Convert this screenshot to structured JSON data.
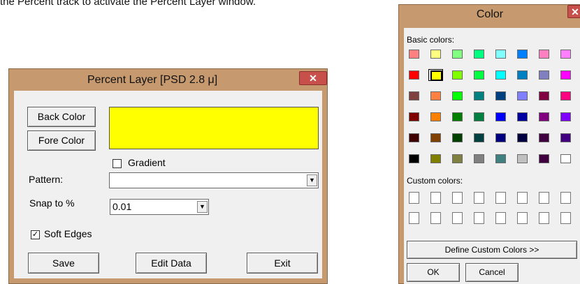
{
  "caption": "the Percent track to activate the Percent Layer window.",
  "percent_layer": {
    "title": "Percent Layer [PSD 2.8 μ]",
    "close_glyph": "✕",
    "back_color_label": "Back Color",
    "fore_color_label": "Fore Color",
    "preview_color": "#ffff00",
    "gradient_label": "Gradient",
    "gradient_checked": false,
    "pattern_label": "Pattern:",
    "pattern_value": "",
    "snap_label": "Snap to %",
    "snap_value": "0.01",
    "soft_edges_label": "Soft Edges",
    "soft_edges_checked": true,
    "save_label": "Save",
    "edit_data_label": "Edit Data",
    "exit_label": "Exit"
  },
  "color_dialog": {
    "title": "Color",
    "close_glyph": "✕",
    "basic_colors_label": "Basic colors:",
    "basic_colors": [
      [
        "#ff8080",
        "#ffff80",
        "#80ff80",
        "#00ff80",
        "#80ffff",
        "#0080ff",
        "#ff80c0",
        "#ff80ff"
      ],
      [
        "#ff0000",
        "#ffff00",
        "#80ff00",
        "#00ff40",
        "#00ffff",
        "#0080c0",
        "#8080c0",
        "#ff00ff"
      ],
      [
        "#804040",
        "#ff8040",
        "#00ff00",
        "#008080",
        "#004080",
        "#8080ff",
        "#800040",
        "#ff0080"
      ],
      [
        "#800000",
        "#ff8000",
        "#008000",
        "#008040",
        "#0000ff",
        "#0000a0",
        "#800080",
        "#8000ff"
      ],
      [
        "#400000",
        "#804000",
        "#004000",
        "#004040",
        "#000080",
        "#000040",
        "#400040",
        "#400080"
      ],
      [
        "#000000",
        "#808000",
        "#808040",
        "#808080",
        "#408080",
        "#c0c0c0",
        "#400040",
        "#ffffff"
      ]
    ],
    "selected_color": "#ffff00",
    "custom_colors_label": "Custom colors:",
    "define_custom_label": "Define Custom Colors >>",
    "ok_label": "OK",
    "cancel_label": "Cancel"
  }
}
